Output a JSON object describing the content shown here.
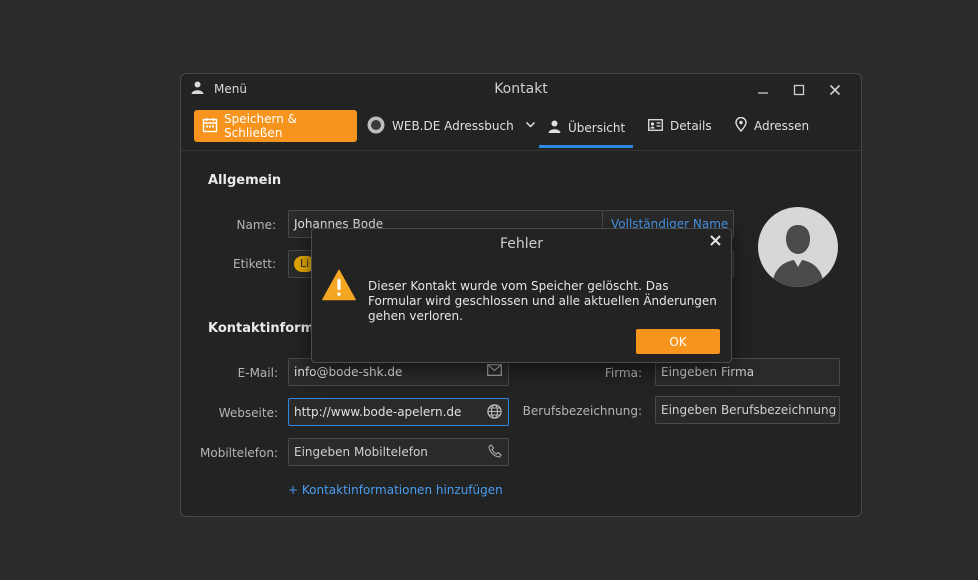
{
  "window": {
    "title": "Kontakt",
    "menu_label": "Menü"
  },
  "toolbar": {
    "save_label": "Speichern & Schließen",
    "addressbook_label": "WEB.DE Adressbuch",
    "tabs": [
      {
        "label": "Übersicht",
        "active": true
      },
      {
        "label": "Details"
      },
      {
        "label": "Adressen"
      }
    ]
  },
  "general": {
    "heading": "Allgemein",
    "name_label": "Name:",
    "name_value": "Johannes Bode",
    "fullname_link": "Vollständiger Name",
    "label_label": "Etikett:",
    "label_badge": "Li"
  },
  "contact": {
    "heading": "Kontaktinformat",
    "email_label": "E-Mail:",
    "email_value": "info@bode-shk.de",
    "website_label": "Webseite:",
    "website_value": "http://www.bode-apelern.de",
    "mobile_label": "Mobiltelefon:",
    "mobile_placeholder": "Eingeben Mobiltelefon",
    "company_label": "Firma:",
    "company_placeholder": "Eingeben Firma",
    "job_label": "Berufsbezeichnung:",
    "job_placeholder": "Eingeben Berufsbezeichnung",
    "add_link": "+ Kontaktinformationen hinzufügen"
  },
  "dialog": {
    "title": "Fehler",
    "message": "Dieser Kontakt wurde vom Speicher gelöscht. Das Formular wird geschlossen und alle aktuellen Änderungen gehen verloren.",
    "ok_label": "OK"
  },
  "colors": {
    "accent": "#f7941d",
    "focus": "#2f86e4",
    "warning": "#f5a623"
  }
}
